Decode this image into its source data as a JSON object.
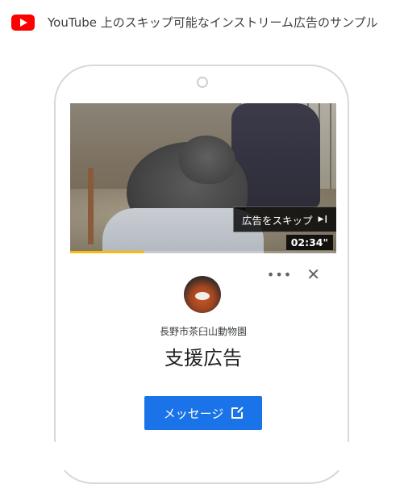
{
  "header": {
    "title": "YouTube 上のスキップ可能なインストリーム広告のサンプル",
    "logo_icon": "youtube-logo-icon",
    "logo_color": "#ff0000"
  },
  "video": {
    "skip_label": "広告をスキップ",
    "skip_icon": "skip-next-icon",
    "time": "02:34\"",
    "progress": 0.28,
    "progress_color": "#fbbc04"
  },
  "card": {
    "more_icon": "more-horiz-icon",
    "close_icon": "close-icon",
    "channel_name": "長野市茶臼山動物園",
    "ad_title": "支援広告",
    "cta_label": "メッセージ",
    "cta_icon": "open-in-new-icon",
    "cta_color": "#1a73e8"
  }
}
